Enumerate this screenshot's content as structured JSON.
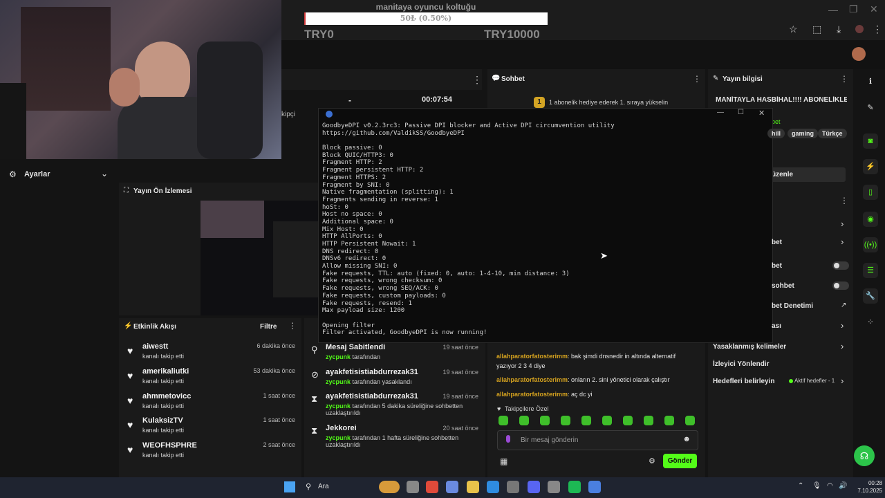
{
  "webcam": {
    "label": "webcam-overlay"
  },
  "donation": {
    "title": "manitaya oyuncu koltuğu",
    "progress_text": "50₺ (0.50%)",
    "progress_fraction": 0.005,
    "min_label": "TRY0",
    "max_label": "TRY10000"
  },
  "stream_header": {
    "timer": "00:07:54",
    "dash": "-",
    "kipci": "kipçi"
  },
  "settings": {
    "label": "Ayarlar"
  },
  "preview": {
    "title": "Yayın Ön İzlemesi"
  },
  "activity": {
    "title": "Etkinlik Akışı",
    "filter_label": "Filtre",
    "items": [
      {
        "name": "aiwestt",
        "sub": "kanalı takip etti",
        "time": "6 dakika önce"
      },
      {
        "name": "amerikaliutki",
        "sub": "kanalı takip etti",
        "time": "53 dakika önce"
      },
      {
        "name": "ahmmetovicc",
        "sub": "kanalı takip etti",
        "time": "1 saat önce"
      },
      {
        "name": "KulaksizTV",
        "sub": "kanalı takip etti",
        "time": "1 saat önce"
      },
      {
        "name": "WEOFHSPHRE",
        "sub": "kanalı takip etti",
        "time": "2 saat önce"
      }
    ]
  },
  "modlog": {
    "items": [
      {
        "title": "Mesaj Sabitlendi",
        "time": "19 saat önce",
        "user": "zycpunk",
        "text": "tarafından"
      },
      {
        "title": "ayakfetisistiabdurrezak31",
        "time": "19 saat önce",
        "user": "zycpunk",
        "text": "tarafından yasaklandı"
      },
      {
        "title": "ayakfetisistiabdurrezak31",
        "time": "19 saat önce",
        "user": "zycpunk",
        "text": "tarafından 5 dakika süreliğine sohbetten uzaklaştırıldı"
      },
      {
        "title": "Jekkorei",
        "time": "20 saat önce",
        "user": "zycpunk",
        "text": "tarafından 1 hafta süreliğine sohbetten uzaklaştırıldı"
      }
    ]
  },
  "chat": {
    "title": "Sohbet",
    "gift_banner": "1 abonelik hediye ederek 1. sıraya yükselin",
    "gift_rank": "1",
    "messages": [
      {
        "user": "allahparatorfatosterimm",
        "text": "bak şimdi dnsnedir in altında alternatif yazıyor 2 3 4 diye"
      },
      {
        "user": "allahparatorfatosterimm",
        "text": "onların 2. sini yönetici olarak çalıştır"
      },
      {
        "user": "allahparatorfatosterimm",
        "text": "aç dc yi"
      }
    ],
    "followers_only": "Takipçilere Özel",
    "input_placeholder": "Bir mesaj gönderin",
    "send_label": "Gönder"
  },
  "stream_info": {
    "title": "Yayın bilgisi",
    "stream_title": "MANİTAYLA HASBİHAL!!!! ABONELİKLER",
    "bet": "bet",
    "tags": [
      "hill",
      "gaming",
      "Türkçe"
    ],
    "edit_label": "üzenle",
    "rows": [
      {
        "label": "bet",
        "kind": "chevron"
      },
      {
        "label": "bet",
        "kind": "toggle"
      },
      {
        "label": "sohbet",
        "kind": "toggle"
      },
      {
        "label": "bet Denetimi",
        "kind": "external"
      },
      {
        "label": "ası",
        "kind": "chevron"
      },
      {
        "label": "Yasaklanmış kelimeler",
        "kind": "chevron"
      },
      {
        "label": "İzleyici Yönlendir",
        "kind": "none"
      },
      {
        "label": "Hedefleri belirleyin",
        "kind": "chevron"
      }
    ],
    "active_goals": "Aktif hedefler - 1"
  },
  "console": {
    "lines": [
      "GoodbyeDPI v0.2.3rc3: Passive DPI blocker and Active DPI circumvention utility",
      "https://github.com/ValdikSS/GoodbyeDPI",
      "",
      "Block passive: 0",
      "Block QUIC/HTTP3: 0",
      "Fragment HTTP: 2",
      "Fragment persistent HTTP: 2",
      "Fragment HTTPS: 2",
      "Fragment by SNI: 0",
      "Native fragmentation (splitting): 1",
      "Fragments sending in reverse: 1",
      "hoSt: 0",
      "Host no space: 0",
      "Additional space: 0",
      "Mix Host: 0",
      "HTTP AllPorts: 0",
      "HTTP Persistent Nowait: 1",
      "DNS redirect: 0",
      "DNSv6 redirect: 0",
      "Allow missing SNI: 0",
      "Fake requests, TTL: auto (fixed: 0, auto: 1-4-10, min distance: 3)",
      "Fake requests, wrong checksum: 0",
      "Fake requests, wrong SEQ/ACK: 0",
      "Fake requests, custom payloads: 0",
      "Fake requests, resend: 1",
      "Max payload size: 1200",
      "",
      "Opening filter",
      "Filter activated, GoodbyeDPI is now running!"
    ]
  },
  "taskbar": {
    "search_label": "Ara",
    "time": "00:28",
    "date": "7.10.2025"
  },
  "colors": {
    "accent": "#53fc18",
    "bg": "#141414",
    "panel": "#1e1e1f",
    "username": "#d6a31f"
  }
}
